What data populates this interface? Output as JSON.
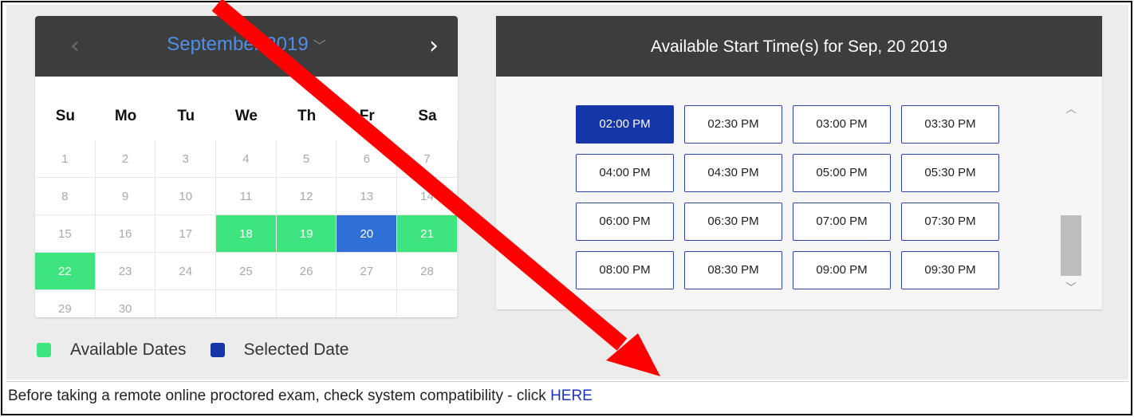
{
  "calendar": {
    "month_label": "September 2019",
    "prev_glyph": "‹",
    "next_glyph": "›",
    "caret_glyph": "﹀",
    "weekdays": [
      "Su",
      "Mo",
      "Tu",
      "We",
      "Th",
      "Fr",
      "Sa"
    ],
    "weeks": [
      [
        {
          "d": "1",
          "s": "unavailable"
        },
        {
          "d": "2",
          "s": "unavailable"
        },
        {
          "d": "3",
          "s": "unavailable"
        },
        {
          "d": "4",
          "s": "unavailable"
        },
        {
          "d": "5",
          "s": "unavailable"
        },
        {
          "d": "6",
          "s": "unavailable"
        },
        {
          "d": "7",
          "s": "unavailable"
        }
      ],
      [
        {
          "d": "8",
          "s": "unavailable"
        },
        {
          "d": "9",
          "s": "unavailable"
        },
        {
          "d": "10",
          "s": "unavailable"
        },
        {
          "d": "11",
          "s": "unavailable"
        },
        {
          "d": "12",
          "s": "unavailable"
        },
        {
          "d": "13",
          "s": "unavailable"
        },
        {
          "d": "14",
          "s": "unavailable"
        }
      ],
      [
        {
          "d": "15",
          "s": "unavailable"
        },
        {
          "d": "16",
          "s": "unavailable"
        },
        {
          "d": "17",
          "s": "unavailable"
        },
        {
          "d": "18",
          "s": "available"
        },
        {
          "d": "19",
          "s": "available"
        },
        {
          "d": "20",
          "s": "selected"
        },
        {
          "d": "21",
          "s": "available"
        }
      ],
      [
        {
          "d": "22",
          "s": "available"
        },
        {
          "d": "23",
          "s": "unavailable"
        },
        {
          "d": "24",
          "s": "unavailable"
        },
        {
          "d": "25",
          "s": "unavailable"
        },
        {
          "d": "26",
          "s": "unavailable"
        },
        {
          "d": "27",
          "s": "unavailable"
        },
        {
          "d": "28",
          "s": "unavailable"
        }
      ],
      [
        {
          "d": "29",
          "s": "unavailable"
        },
        {
          "d": "30",
          "s": "unavailable"
        },
        {
          "d": "",
          "s": "empty"
        },
        {
          "d": "",
          "s": "empty"
        },
        {
          "d": "",
          "s": "empty"
        },
        {
          "d": "",
          "s": "empty"
        },
        {
          "d": "",
          "s": "empty"
        }
      ]
    ]
  },
  "legend": {
    "available_label": "Available Dates",
    "selected_label": "Selected Date",
    "available_color": "#3ee57f",
    "selected_color": "#1536a6"
  },
  "times": {
    "header": "Available Start Time(s) for Sep, 20 2019",
    "selected": "02:00 PM",
    "slots": [
      "02:00 PM",
      "02:30 PM",
      "03:00 PM",
      "03:30 PM",
      "04:00 PM",
      "04:30 PM",
      "05:00 PM",
      "05:30 PM",
      "06:00 PM",
      "06:30 PM",
      "07:00 PM",
      "07:30 PM",
      "08:00 PM",
      "08:30 PM",
      "09:00 PM",
      "09:30 PM"
    ],
    "scroll_up_glyph": "︿",
    "scroll_down_glyph": "﹀"
  },
  "footer": {
    "text": "Before taking a remote online proctored exam, check system compatibility - click ",
    "link_label": "HERE"
  },
  "colors": {
    "header_bg": "#3d3d3d",
    "month_label": "#4f8fe8",
    "arrow": "#ff0000"
  }
}
